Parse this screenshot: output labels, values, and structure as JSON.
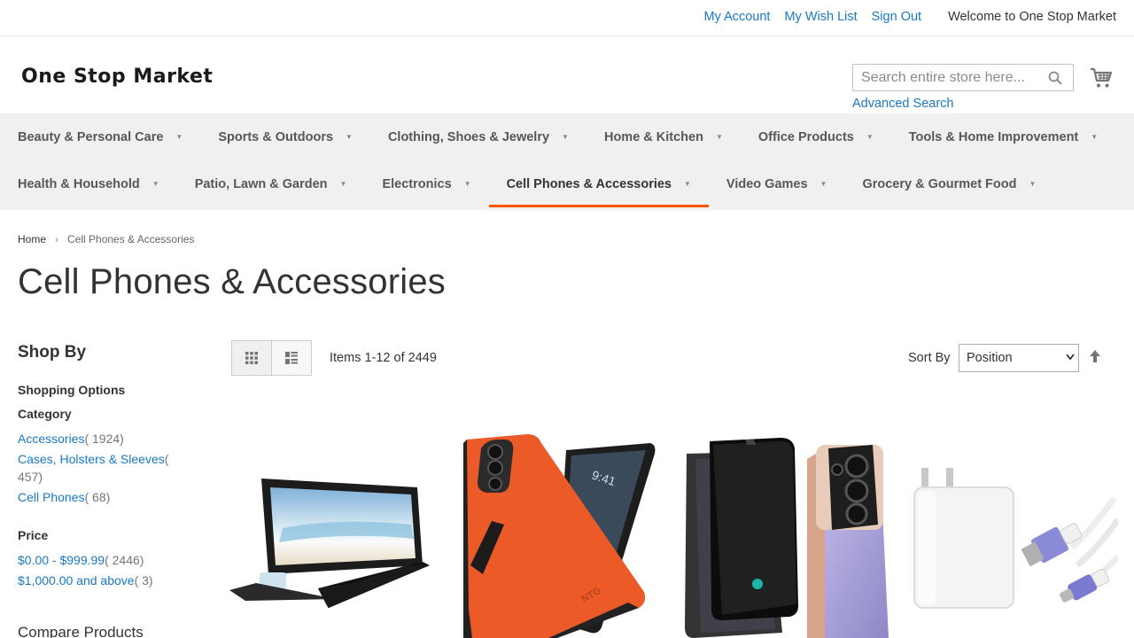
{
  "top_links": {
    "my_account": "My Account",
    "wish_list": "My Wish List",
    "sign_out": "Sign Out",
    "welcome": "Welcome to One Stop Market"
  },
  "header": {
    "logo_text": "One Stop Market",
    "search_placeholder": "Search entire store here...",
    "advanced_search": "Advanced Search",
    "search_icon": "search-icon",
    "cart_icon": "cart-icon"
  },
  "nav": {
    "row1": [
      "Beauty & Personal Care",
      "Sports & Outdoors",
      "Clothing, Shoes & Jewelry",
      "Home & Kitchen",
      "Office Products",
      "Tools & Home Improvement"
    ],
    "row2": [
      "Health & Household",
      "Patio, Lawn & Garden",
      "Electronics",
      "Cell Phones & Accessories",
      "Video Games",
      "Grocery & Gourmet Food"
    ],
    "active": "Cell Phones & Accessories",
    "accent_color": "#ff5501"
  },
  "breadcrumb": {
    "home": "Home",
    "current": "Cell Phones & Accessories"
  },
  "page_title": "Cell Phones & Accessories",
  "sidebar": {
    "shop_by": "Shop By",
    "shopping_options": "Shopping Options",
    "category_title": "Category",
    "categories": [
      {
        "label": "Accessories",
        "count": "( 1924)"
      },
      {
        "label": "Cases, Holsters & Sleeves",
        "count": "( 457)"
      },
      {
        "label": "Cell Phones",
        "count": "( 68)"
      }
    ],
    "price_title": "Price",
    "prices": [
      {
        "label": "$0.00 - $999.99",
        "count": "( 2446)"
      },
      {
        "label": "$1,000.00 and above",
        "count": "( 3)"
      }
    ],
    "compare_title": "Compare Products"
  },
  "toolbar": {
    "grid_icon": "grid-view-icon",
    "list_icon": "list-view-icon",
    "items_count": "Items 1-12 of 2449",
    "sort_label": "Sort By",
    "sort_value": "Position",
    "sort_direction_icon": "sort-arrow-up-icon"
  },
  "products": [
    {
      "image": "magnifier-screen-stand"
    },
    {
      "image": "orange-phone-case"
    },
    {
      "image": "privacy-screen-protector"
    },
    {
      "image": "usb-c-charger-cable"
    }
  ],
  "link_color": "#1979c3"
}
